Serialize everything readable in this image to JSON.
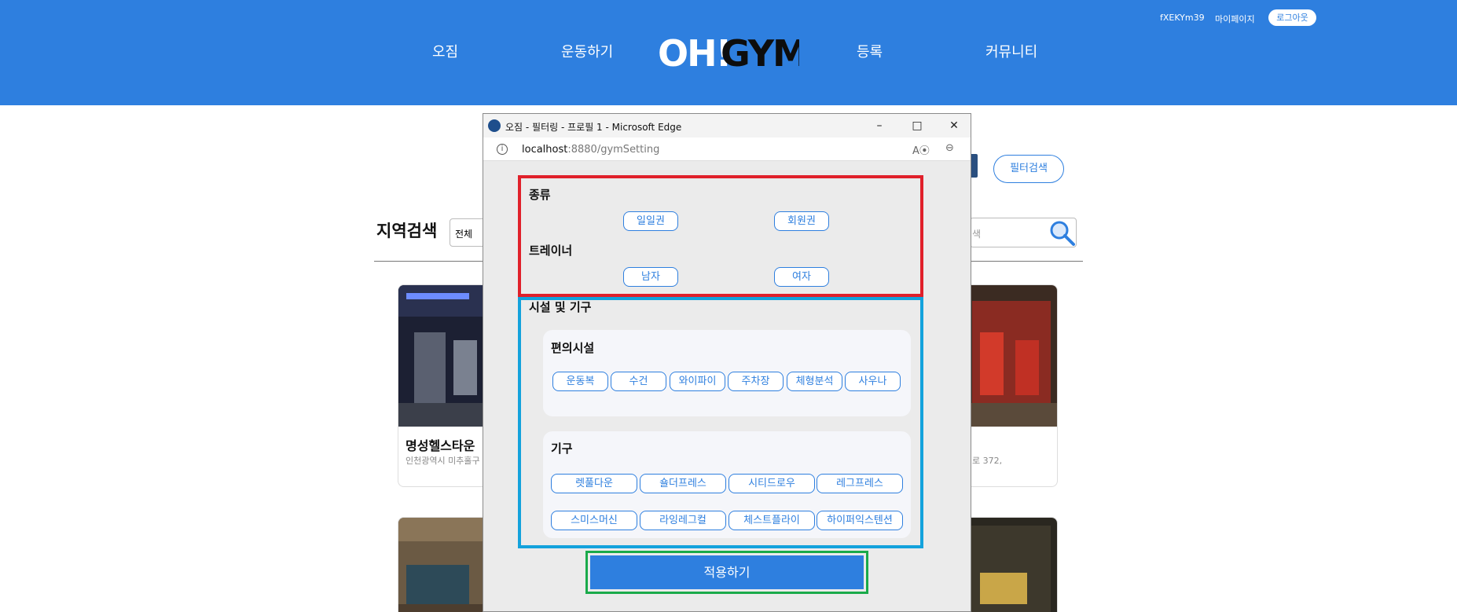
{
  "header": {
    "nav": [
      "오짐",
      "운동하기",
      "등록",
      "커뮤니티"
    ],
    "logo_text": "OH!GYM",
    "username": "fXEKYm39",
    "mypage": "마이페이지",
    "logout": "로그아웃"
  },
  "page": {
    "filter_search": "필터검색",
    "region_label": "지역검색",
    "region_select_value": "전체",
    "search_placeholder": "색",
    "cards": [
      {
        "title": "명성헬스타운",
        "address": "인천광역시 미추홀구"
      },
      {
        "title": "",
        "address": "로 372,"
      }
    ]
  },
  "popup": {
    "window_title": "오짐 - 필터링 - 프로필 1 - Microsoft Edge",
    "url_host": "localhost",
    "url_path": ":8880/gymSetting",
    "sections": {
      "type_title": "종류",
      "type_options": [
        "일일권",
        "회원권"
      ],
      "trainer_title": "트레이너",
      "trainer_options": [
        "남자",
        "여자"
      ],
      "facility_title": "시설 및 기구",
      "convenience_title": "편의시설",
      "convenience_options": [
        "운동복",
        "수건",
        "와이파이",
        "주차장",
        "체형분석",
        "사우나"
      ],
      "equipment_title": "기구",
      "equipment_options_row1": [
        "렛풀다운",
        "숄더프레스",
        "시티드로우",
        "레그프레스"
      ],
      "equipment_options_row2": [
        "스미스머신",
        "라잉레그컬",
        "체스트플라이",
        "하이퍼익스텐션"
      ]
    },
    "apply": "적용하기"
  },
  "colors": {
    "brand_blue": "#2e7fdf",
    "highlight_red": "#e0202a",
    "highlight_blue": "#13a2dc",
    "highlight_green": "#1aaa4a"
  }
}
